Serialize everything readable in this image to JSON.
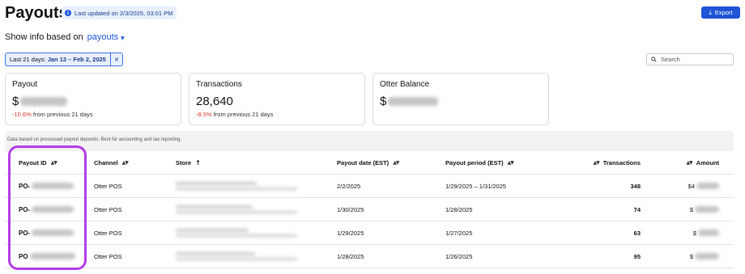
{
  "header": {
    "title": "Payouts",
    "updated_text": "Last updated on 2/3/2025, 03:01 PM",
    "export_label": "Export"
  },
  "show_info": {
    "prefix": "Show info based on",
    "selected": "payouts"
  },
  "filter": {
    "prefix": "Last 21 days:",
    "range": "Jan 13 – Feb 2, 2025",
    "clear": "×"
  },
  "search": {
    "placeholder": "Search"
  },
  "cards": [
    {
      "label": "Payout",
      "value": "$",
      "change": "-10.6%",
      "change_suffix": "from previous 21 days"
    },
    {
      "label": "Transactions",
      "value": "28,640",
      "change": "-8.5%",
      "change_suffix": "from previous 21 days"
    },
    {
      "label": "Otter Balance",
      "value": "$"
    }
  ],
  "table": {
    "note": "Data based on processed payout deposits. Best for accounting and tax reporting.",
    "headers": {
      "payout_id": "Payout ID",
      "channel": "Channel",
      "store": "Store",
      "payout_date": "Payout date (EST)",
      "payout_period": "Payout period (EST)",
      "transactions": "Transactions",
      "amount": "Amount"
    },
    "rows": [
      {
        "payout_id": "PO-",
        "channel": "Otter POS",
        "payout_date": "2/2/2025",
        "payout_period": "1/29/2025 – 1/31/2025",
        "transactions": "348",
        "amount": "$4"
      },
      {
        "payout_id": "PO-",
        "channel": "Otter POS",
        "payout_date": "1/30/2025",
        "payout_period": "1/28/2025",
        "transactions": "74",
        "amount": "$"
      },
      {
        "payout_id": "PO-",
        "channel": "Otter POS",
        "payout_date": "1/29/2025",
        "payout_period": "1/27/2025",
        "transactions": "63",
        "amount": "$"
      },
      {
        "payout_id": "PO",
        "channel": "Otter POS",
        "payout_date": "1/28/2025",
        "payout_period": "1/26/2025",
        "transactions": "95",
        "amount": "$"
      }
    ]
  },
  "colors": {
    "accent": "#1f54d6",
    "highlight": "#b53de8",
    "negative": "#d0342c"
  }
}
